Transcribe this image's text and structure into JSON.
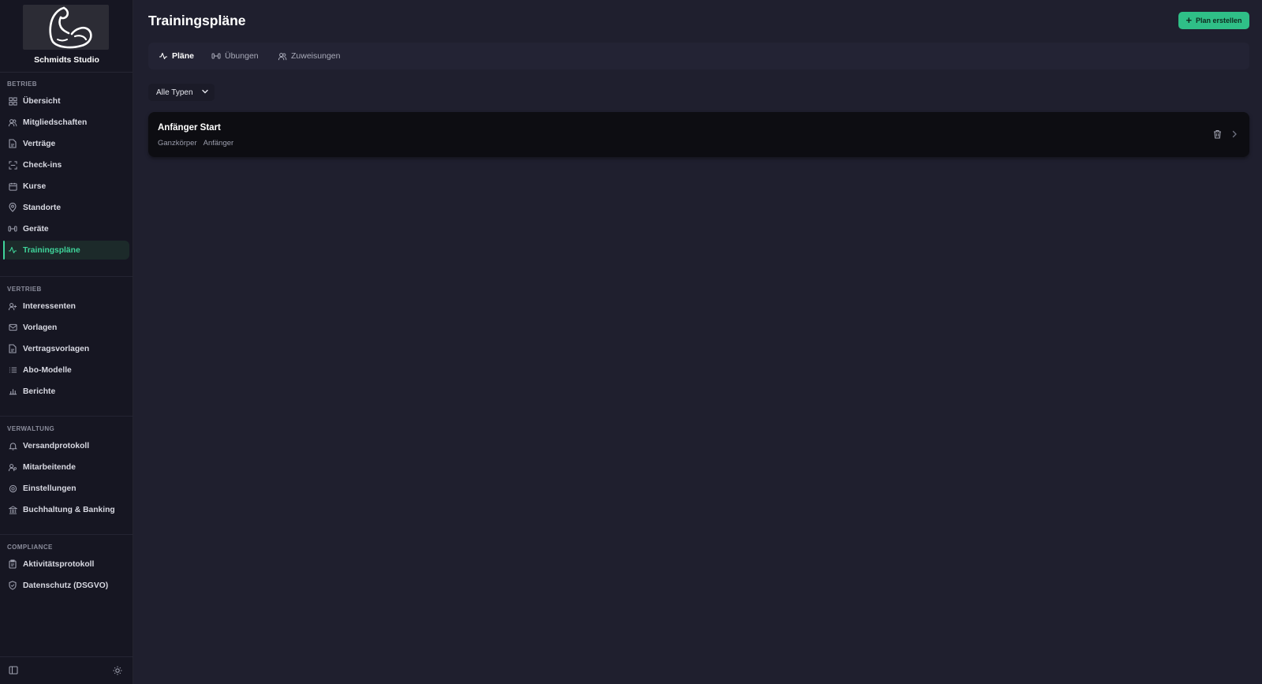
{
  "brand": {
    "name": "Schmidts Studio",
    "logo_icon": "flexed-arm-icon"
  },
  "sidebar": {
    "sections": [
      {
        "label": "BETRIEB",
        "items": [
          {
            "label": "Übersicht",
            "icon": "grid-icon"
          },
          {
            "label": "Mitgliedschaften",
            "icon": "users-icon"
          },
          {
            "label": "Verträge",
            "icon": "file-icon"
          },
          {
            "label": "Check-ins",
            "icon": "scan-icon"
          },
          {
            "label": "Kurse",
            "icon": "calendar-icon"
          },
          {
            "label": "Standorte",
            "icon": "map-pin-icon"
          },
          {
            "label": "Geräte",
            "icon": "dumbbell-icon"
          },
          {
            "label": "Trainingspläne",
            "icon": "activity-icon",
            "active": true
          }
        ]
      },
      {
        "label": "VERTRIEB",
        "items": [
          {
            "label": "Interessenten",
            "icon": "user-plus-icon"
          },
          {
            "label": "Vorlagen",
            "icon": "mail-icon"
          },
          {
            "label": "Vertragsvorlagen",
            "icon": "file-icon"
          },
          {
            "label": "Abo-Modelle",
            "icon": "list-icon"
          },
          {
            "label": "Berichte",
            "icon": "bar-chart-icon"
          }
        ]
      },
      {
        "label": "VERWALTUNG",
        "items": [
          {
            "label": "Versandprotokoll",
            "icon": "bell-icon"
          },
          {
            "label": "Mitarbeitende",
            "icon": "user-cog-icon"
          },
          {
            "label": "Einstellungen",
            "icon": "settings-icon"
          },
          {
            "label": "Buchhaltung & Banking",
            "icon": "bank-icon"
          }
        ]
      },
      {
        "label": "COMPLIANCE",
        "items": [
          {
            "label": "Aktivitätsprotokoll",
            "icon": "clipboard-icon"
          },
          {
            "label": "Datenschutz (DSGVO)",
            "icon": "shield-icon"
          }
        ]
      }
    ],
    "footer": {
      "collapse_icon": "sidebar-toggle-icon",
      "theme_icon": "sun-icon"
    }
  },
  "header": {
    "title": "Trainingspläne",
    "create_label": "Plan erstellen"
  },
  "tabs": [
    {
      "label": "Pläne",
      "icon": "activity-icon",
      "active": true
    },
    {
      "label": "Übungen",
      "icon": "dumbbell-icon"
    },
    {
      "label": "Zuweisungen",
      "icon": "users-icon"
    }
  ],
  "filter": {
    "value": "Alle Typen"
  },
  "plans": [
    {
      "name": "Anfänger Start",
      "tags": [
        "Ganzkörper",
        "Anfänger"
      ]
    }
  ],
  "colors": {
    "accent": "#3fd49a",
    "button": "#2fbf87",
    "background": "#1f1f2e",
    "sidebar": "#161622"
  }
}
